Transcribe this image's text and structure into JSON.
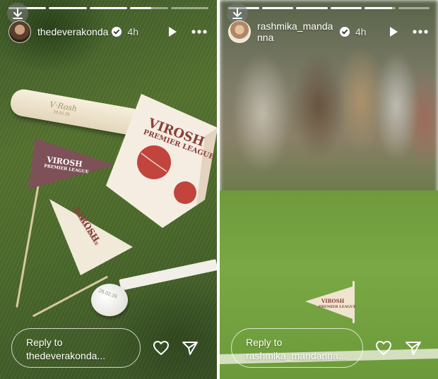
{
  "stories": [
    {
      "username": "thedeverakonda",
      "time": "4h",
      "verified": true,
      "reply_text": "Reply to thedeverakonda...",
      "progress_segments": [
        1,
        1,
        1,
        0.55,
        0
      ],
      "props": {
        "stick_name": "V·Rosh",
        "stick_date": "26.02.26",
        "flag_maroon_title": "VIROSH",
        "flag_maroon_sub": "PREMIER LEAGUE",
        "flag_white_title": "VIROSH",
        "flag_white_sub": "PREMIER LEAGUE",
        "box_title": "VIROSH",
        "box_sub": "PREMIER LEAGUE",
        "medal_text": "26.02.26"
      }
    },
    {
      "username": "rashmika_mandanna",
      "time": "4h",
      "verified": true,
      "reply_text": "Reply to rashmika_mandanna...",
      "progress_segments": [
        1,
        1,
        1,
        1,
        0.9,
        0
      ],
      "props": {
        "flag_title": "VIROSH",
        "flag_sub": "PREMIER LEAGUE"
      }
    }
  ],
  "icons": {
    "download": "download-icon",
    "verified": "verified-badge-icon",
    "play": "play-icon",
    "more": "more-icon",
    "heart": "heart-icon",
    "send": "send-icon"
  },
  "colors": {
    "verified_blue": "#0095f6",
    "brand_maroon": "#8a3f39"
  }
}
